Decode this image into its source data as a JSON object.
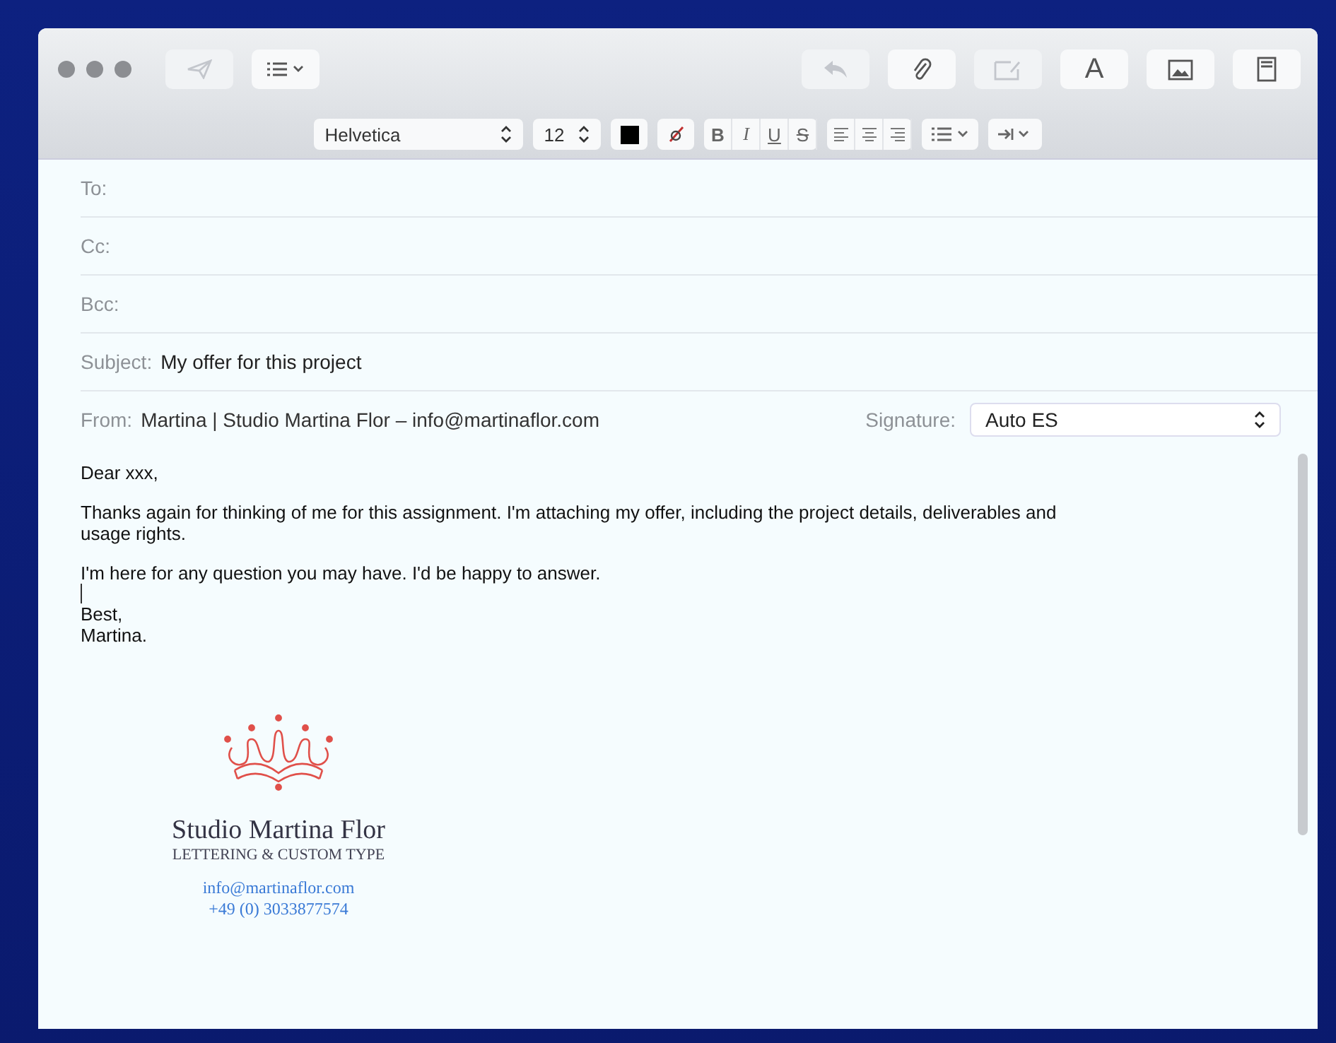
{
  "toolbar": {
    "left": [
      {
        "kind": "send",
        "disabled": true
      },
      {
        "kind": "list"
      }
    ],
    "right": [
      {
        "kind": "reply",
        "disabled": true
      },
      {
        "kind": "attach",
        "disabled": false
      },
      {
        "kind": "markup",
        "disabled": true
      },
      {
        "kind": "font",
        "label": "A",
        "disabled": false
      },
      {
        "kind": "photo",
        "disabled": false
      },
      {
        "kind": "template",
        "disabled": false
      }
    ]
  },
  "format_bar": {
    "font": "Helvetica",
    "size": "12",
    "styles": [
      "B",
      "I",
      "U",
      "S"
    ]
  },
  "fields": [
    {
      "label": "To:"
    },
    {
      "label": "Cc:"
    },
    {
      "label": "Bcc:"
    },
    {
      "label": "Subject:",
      "value": "My offer for this project"
    }
  ],
  "from": {
    "label": "From:",
    "value": "Martina | Studio Martina Flor – info@martinaflor.com",
    "signature_label": "Signature:",
    "signature": "Auto ES"
  },
  "body": [
    "Dear xxx,",
    "Thanks again for thinking of me for this assignment. I'm attaching my offer, including the project details, deliverables and usage rights.",
    "I'm here for any question you may have. I'd be happy to answer.",
    "Best,\nMartina."
  ],
  "signature_block": {
    "name": "Studio Martina Flor",
    "tagline": "LETTERING & CUSTOM TYPE",
    "email": "info@martinaflor.com",
    "phone": "+49 (0) 3033877574"
  }
}
